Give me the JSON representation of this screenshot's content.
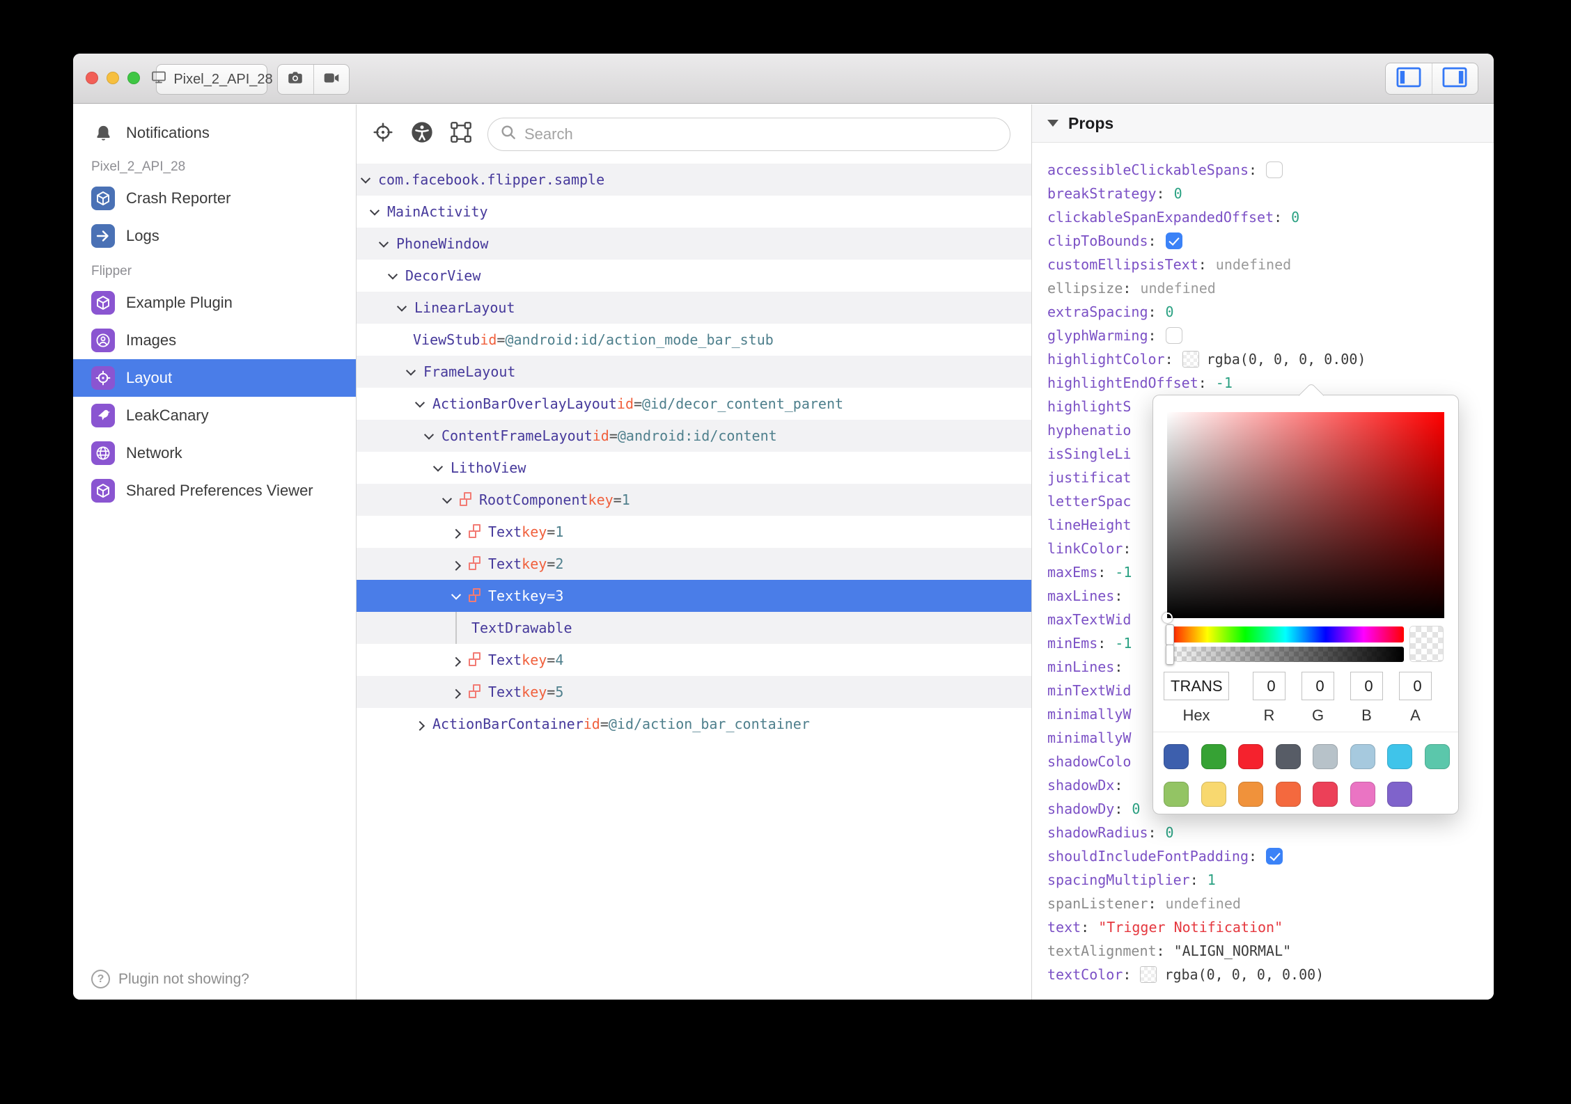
{
  "titlebar": {
    "device_name": "Pixel_2_API_28",
    "window_buttons": [
      "close",
      "minimize",
      "zoom"
    ]
  },
  "sidebar": {
    "items": [
      {
        "type": "item",
        "label": "Notifications",
        "icon": "bell-icon",
        "tile": null
      },
      {
        "type": "section",
        "label": "Pixel_2_API_28"
      },
      {
        "type": "item",
        "label": "Crash Reporter",
        "icon": "cube-icon",
        "tile": "blue"
      },
      {
        "type": "item",
        "label": "Logs",
        "icon": "arrow-right-icon",
        "tile": "blue"
      },
      {
        "type": "section",
        "label": "Flipper"
      },
      {
        "type": "item",
        "label": "Example Plugin",
        "icon": "cube-icon",
        "tile": "purple"
      },
      {
        "type": "item",
        "label": "Images",
        "icon": "user-circle-icon",
        "tile": "purple"
      },
      {
        "type": "item",
        "label": "Layout",
        "icon": "target-icon",
        "tile": "purple",
        "selected": true
      },
      {
        "type": "item",
        "label": "LeakCanary",
        "icon": "bird-icon",
        "tile": "purple"
      },
      {
        "type": "item",
        "label": "Network",
        "icon": "globe-icon",
        "tile": "purple"
      },
      {
        "type": "item",
        "label": "Shared Preferences Viewer",
        "icon": "cube-icon",
        "tile": "purple"
      }
    ],
    "footer_label": "Plugin not showing?"
  },
  "inspector": {
    "search_placeholder": "Search",
    "toolbar_icons": [
      "target-icon",
      "accessibility-icon",
      "select-node-icon"
    ],
    "rows": [
      {
        "name": "com.facebook.flipper.sample",
        "level": 0,
        "state": "expanded"
      },
      {
        "name": "MainActivity",
        "level": 1,
        "state": "expanded"
      },
      {
        "name": "PhoneWindow",
        "level": 2,
        "state": "expanded"
      },
      {
        "name": "DecorView",
        "level": 3,
        "state": "expanded"
      },
      {
        "name": "LinearLayout",
        "level": 4,
        "state": "expanded"
      },
      {
        "name": "ViewStub",
        "attr": "id",
        "attr_value": "@android:id/action_mode_bar_stub",
        "level": 5,
        "state": "leaf"
      },
      {
        "name": "FrameLayout",
        "level": 5,
        "state": "expanded"
      },
      {
        "name": "ActionBarOverlayLayout",
        "attr": "id",
        "attr_value": "@id/decor_content_parent",
        "level": 6,
        "state": "expanded"
      },
      {
        "name": "ContentFrameLayout",
        "attr": "id",
        "attr_value": "@android:id/content",
        "level": 7,
        "state": "expanded"
      },
      {
        "name": "LithoView",
        "level": 8,
        "state": "expanded"
      },
      {
        "name": "RootComponent",
        "attr": "key",
        "attr_value": "1",
        "level": 9,
        "state": "expanded",
        "litho": true
      },
      {
        "name": "Text",
        "attr": "key",
        "attr_value": "1",
        "level": 10,
        "state": "collapsed",
        "litho": true
      },
      {
        "name": "Text",
        "attr": "key",
        "attr_value": "2",
        "level": 10,
        "state": "collapsed",
        "litho": true
      },
      {
        "name": "Text",
        "attr": "key",
        "attr_value": "3",
        "level": 10,
        "state": "expanded",
        "litho": true,
        "selected": true
      },
      {
        "name": "TextDrawable",
        "level": 10,
        "state": "leaf",
        "guide": true
      },
      {
        "name": "Text",
        "attr": "key",
        "attr_value": "4",
        "level": 10,
        "state": "collapsed",
        "litho": true
      },
      {
        "name": "Text",
        "attr": "key",
        "attr_value": "5",
        "level": 10,
        "state": "collapsed",
        "litho": true
      },
      {
        "name": "ActionBarContainer",
        "attr": "id",
        "attr_value": "@id/action_bar_container",
        "level": 6,
        "state": "collapsed"
      }
    ]
  },
  "props": {
    "header": "Props",
    "rows": [
      {
        "name": "accessibleClickableSpans",
        "colon": true,
        "control": "checkbox",
        "checked": false
      },
      {
        "name": "breakStrategy",
        "colon": true,
        "value": "0",
        "value_type": "number"
      },
      {
        "name": "clickableSpanExpandedOffset",
        "colon": true,
        "value": "0",
        "value_type": "number"
      },
      {
        "name": "clipToBounds",
        "colon": true,
        "control": "checkbox",
        "checked": true
      },
      {
        "name": "customEllipsisText",
        "colon": true,
        "value": "undefined",
        "value_type": "undefined"
      },
      {
        "name": "ellipsize",
        "colon": true,
        "gray_name": true,
        "value": "undefined",
        "value_type": "undefined"
      },
      {
        "name": "extraSpacing",
        "colon": true,
        "value": "0",
        "value_type": "number"
      },
      {
        "name": "glyphWarming",
        "colon": true,
        "control": "checkbox",
        "checked": false
      },
      {
        "name": "highlightColor",
        "colon": true,
        "control": "colorwell",
        "value": "rgba(0, 0, 0, 0.00)",
        "value_type": "plain"
      },
      {
        "name": "highlightEndOffset",
        "colon": true,
        "value": "-1",
        "value_type": "number"
      },
      {
        "name": "highlightS",
        "colon": false
      },
      {
        "name": "hyphenatio",
        "colon": false
      },
      {
        "name": "isSingleLi",
        "colon": false
      },
      {
        "name": "justificat",
        "colon": false
      },
      {
        "name": "letterSpac",
        "colon": false
      },
      {
        "name": "lineHeight",
        "colon": false
      },
      {
        "name": "linkColor",
        "colon": true
      },
      {
        "name": "maxEms",
        "colon": true,
        "value": "-1",
        "value_type": "number"
      },
      {
        "name": "maxLines",
        "colon": true
      },
      {
        "name": "maxTextWid",
        "colon": false
      },
      {
        "name": "minEms",
        "colon": true,
        "value": "-1",
        "value_type": "number"
      },
      {
        "name": "minLines",
        "colon": true
      },
      {
        "name": "minTextWid",
        "colon": false
      },
      {
        "name": "minimallyW",
        "colon": false
      },
      {
        "name": "minimallyW",
        "colon": false
      },
      {
        "name": "shadowColo",
        "colon": false
      },
      {
        "name": "shadowDx",
        "colon": true
      },
      {
        "name": "shadowDy",
        "colon": true,
        "value": "0",
        "value_type": "number"
      },
      {
        "name": "shadowRadius",
        "colon": true,
        "value": "0",
        "value_type": "number"
      },
      {
        "name": "shouldIncludeFontPadding",
        "colon": true,
        "control": "checkbox",
        "checked": true
      },
      {
        "name": "spacingMultiplier",
        "colon": true,
        "value": "1",
        "value_type": "number"
      },
      {
        "name": "spanListener",
        "colon": true,
        "gray_name": true,
        "value": "undefined",
        "value_type": "undefined"
      },
      {
        "name": "text",
        "colon": true,
        "value": "\"Trigger Notification\"",
        "value_type": "string"
      },
      {
        "name": "textAlignment",
        "colon": true,
        "gray_name": true,
        "value": "\"ALIGN_NORMAL\"",
        "value_type": "plain"
      },
      {
        "name": "textColor",
        "colon": true,
        "control": "colorwell",
        "value": "rgba(0, 0, 0, 0.00)",
        "value_type": "plain"
      }
    ]
  },
  "color_picker": {
    "hex_value": "TRANS",
    "r_value": "0",
    "g_value": "0",
    "b_value": "0",
    "a_value": "0",
    "field_labels": [
      "Hex",
      "R",
      "G",
      "B",
      "A"
    ],
    "palette_row1": [
      "#3d5fad",
      "#36a234",
      "#f5222d",
      "#575c66",
      "#b7c2c9",
      "#a6c9de",
      "#3fc4ea",
      "#5bc7ab"
    ],
    "palette_row2": [
      "#93c464",
      "#f8d86f",
      "#f0923b",
      "#f4693e",
      "#ec4058",
      "#ea74c3",
      "#7f63cb"
    ]
  },
  "colors": {
    "selection_blue": "#4a7de8",
    "checkbox_blue": "#3b82f7",
    "tree_name_purple": "#46399b",
    "props_name_purple": "#7b50c5",
    "keyword_orange": "#f0603d",
    "attr_value_teal": "#4e7f8c",
    "number_green": "#2aa182",
    "string_red": "#e5383f",
    "litho_icon_pink": "#f27b74",
    "device_plugin_blue": "#4a71b5",
    "flipper_plugin_purple": "#8a55d1"
  }
}
